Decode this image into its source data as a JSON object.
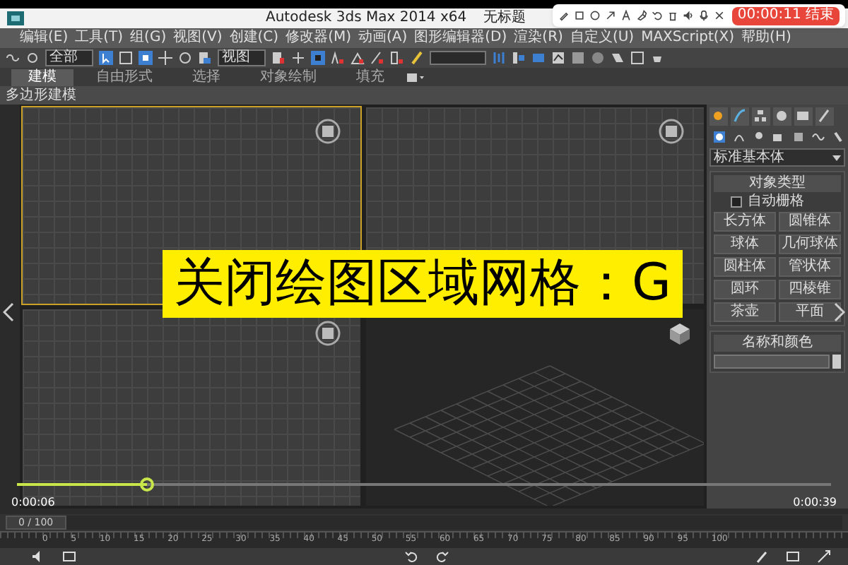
{
  "recorder": {
    "timer_button": "00:00:11 结束"
  },
  "window": {
    "title": "Autodesk 3ds Max 2014 x64",
    "document": "无标题"
  },
  "menu": [
    "编辑(E)",
    "工具(T)",
    "组(G)",
    "视图(V)",
    "创建(C)",
    "修改器(M)",
    "动画(A)",
    "图形编辑器(D)",
    "渲染(R)",
    "自定义(U)",
    "MAXScript(X)",
    "帮助(H)"
  ],
  "main_toolbar": {
    "selection_filter": "全部",
    "reference_coord": "视图"
  },
  "ribbon_tabs": [
    {
      "label": "建模",
      "selected": true
    },
    {
      "label": "自由形式",
      "selected": false
    },
    {
      "label": "选择",
      "selected": false
    },
    {
      "label": "对象绘制",
      "selected": false
    },
    {
      "label": "填充",
      "selected": false
    }
  ],
  "ribbon_panel": "多边形建模",
  "viewports": [
    {
      "kind": "ortho",
      "active": true
    },
    {
      "kind": "ortho",
      "active": false
    },
    {
      "kind": "ortho",
      "active": false
    },
    {
      "kind": "perspective",
      "active": false
    }
  ],
  "command_panel": {
    "dropdown": "标准基本体",
    "object_type": {
      "title": "对象类型",
      "autogrid": {
        "label": "自动栅格",
        "checked": false
      },
      "buttons": [
        "长方体",
        "圆锥体",
        "球体",
        "几何球体",
        "圆柱体",
        "管状体",
        "圆环",
        "四棱锥",
        "茶壶",
        "平面"
      ]
    },
    "name_color": {
      "title": "名称和颜色"
    }
  },
  "caption": "关闭绘图区域网格：G",
  "timeline": {
    "frame": "0 / 100",
    "level": 0,
    "ticks": [
      "0",
      "5",
      "10",
      "15",
      "20",
      "25",
      "30",
      "35",
      "40",
      "45",
      "50",
      "55",
      "60",
      "65",
      "70",
      "75",
      "80",
      "85",
      "90",
      "95",
      "100"
    ]
  },
  "playback": {
    "level": 0.16,
    "elapsed": "0:00:06",
    "total": "0:00:39"
  }
}
